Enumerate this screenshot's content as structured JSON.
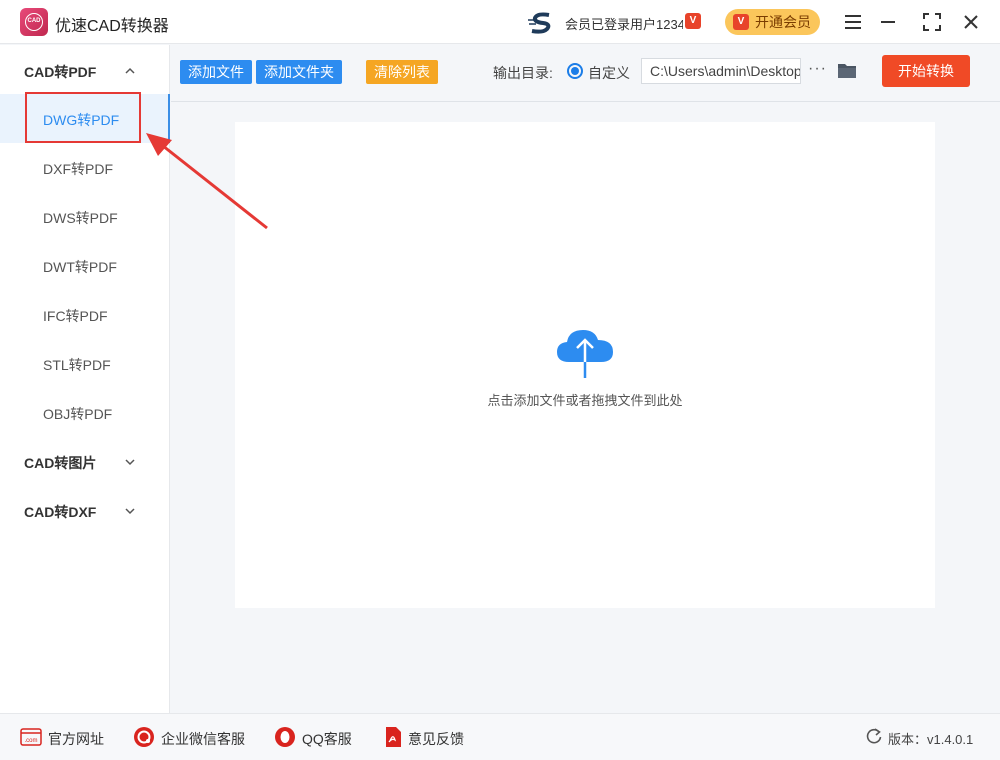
{
  "titlebar": {
    "app_title": "优速CAD转换器",
    "logo_text": "CAD",
    "user_text": "会员已登录用户1234",
    "vip_badge": "V",
    "vip_button": "开通会员"
  },
  "sidebar": {
    "groups": [
      {
        "label": "CAD转PDF",
        "expanded": true
      },
      {
        "label": "CAD转图片",
        "expanded": false
      },
      {
        "label": "CAD转DXF",
        "expanded": false
      }
    ],
    "items": [
      "DWG转PDF",
      "DXF转PDF",
      "DWS转PDF",
      "DWT转PDF",
      "IFC转PDF",
      "STL转PDF",
      "OBJ转PDF"
    ],
    "active_item": "DWG转PDF"
  },
  "toolbar": {
    "add_file": "添加文件",
    "add_folder": "添加文件夹",
    "clear_list": "清除列表",
    "output_label": "输出目录:",
    "radio_label": "自定义",
    "path_value": "C:\\Users\\admin\\Desktop",
    "more": "···",
    "start": "开始转换"
  },
  "dropzone": {
    "hint": "点击添加文件或者拖拽文件到此处"
  },
  "footer": {
    "website": "官方网址",
    "wechat": "企业微信客服",
    "qq": "QQ客服",
    "feedback": "意见反馈",
    "version": "版本：v1.4.0.1",
    "website_icon_text": ".com"
  },
  "colors": {
    "primary_blue": "#2d8cf0",
    "orange": "#f5a623",
    "start_red": "#f04a26",
    "vip_gold": "#fbc65b"
  }
}
